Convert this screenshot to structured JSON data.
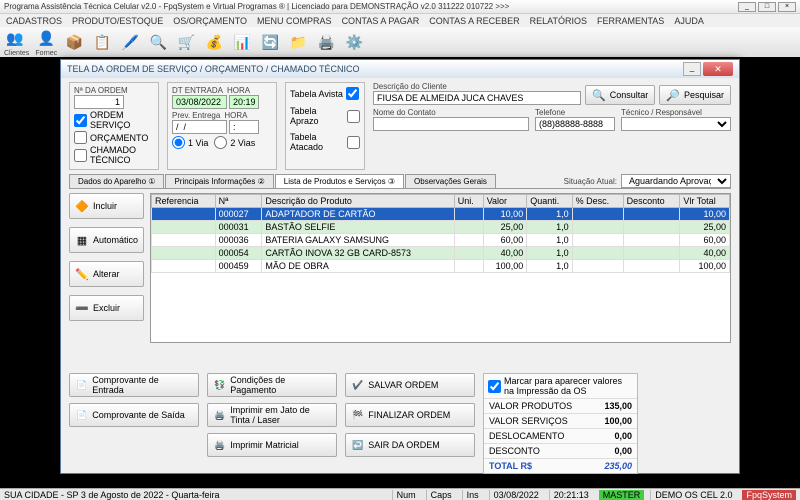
{
  "window": {
    "title": "Programa Assistência Técnica Celular v2.0 - FpqSystem e Virtual Programas ® | Licenciado para DEMONSTRAÇÃO v2.0 311222 010722 >>>"
  },
  "menu": [
    "CADASTROS",
    "PRODUTO/ESTOQUE",
    "OS/ORÇAMENTO",
    "MENU COMPRAS",
    "CONTAS A PAGAR",
    "CONTAS A RECEBER",
    "RELATÓRIOS",
    "FERRAMENTAS",
    "AJUDA"
  ],
  "toolbar": {
    "clientes": "Clientes",
    "fornec": "Fornec"
  },
  "dialog": {
    "title": "TELA DA ORDEM DE SERVIÇO / ORÇAMENTO / CHAMADO TÉCNICO",
    "ordem_lbl": "Nª DA ORDEM",
    "ordem_val": "1",
    "ordem_servico": "ORDEM SERVIÇO",
    "orcamento": "ORÇAMENTO",
    "chamado": "CHAMADO TÉCNICO",
    "dt_entrada_lbl": "DT ENTRADA",
    "dt_entrada": "03/08/2022",
    "hora_lbl": "HORA",
    "hora": "20:19",
    "prev_lbl": "Prev. Entrega",
    "prev": "/  /",
    "prev_hora": ":",
    "via1": "1 Via",
    "via2": "2 Vias",
    "tabela_avista": "Tabela Avista",
    "tabela_aprazo": "Tabela Aprazo",
    "tabela_atacado": "Tabela Atacado",
    "desc_cliente_lbl": "Descrição do Cliente",
    "desc_cliente": "FIUSA DE ALMEIDA JUCA CHAVES",
    "nome_contato_lbl": "Nome do Contato",
    "telefone_lbl": "Telefone",
    "telefone": "(88)88888-8888",
    "tecnico_lbl": "Técnico / Responsável",
    "consultar": "Consultar",
    "pesquisar": "Pesquisar",
    "tabs": [
      "Dados do Aparelho ①",
      "Principais Informações ②",
      "Lista de Produtos e Serviços ③",
      "Observações Gerais"
    ],
    "situacao_lbl": "Situação Atual:",
    "situacao": "Aguardando Aprovação",
    "side": {
      "incluir": "Incluir",
      "automatico": "Automático",
      "alterar": "Alterar",
      "excluir": "Excluir"
    },
    "grid": {
      "headers": [
        "Referencia",
        "Nª",
        "Descrição do Produto",
        "Uni.",
        "Valor",
        "Quanti.",
        "% Desc.",
        "Desconto",
        "Vlr Total"
      ],
      "rows": [
        {
          "ref": "",
          "n": "000027",
          "desc": "ADAPTADOR DE CARTÃO",
          "uni": "",
          "valor": "10,00",
          "qt": "1,0",
          "pd": "",
          "dc": "",
          "tot": "10,00"
        },
        {
          "ref": "",
          "n": "000031",
          "desc": "BASTÃO SELFIE",
          "uni": "",
          "valor": "25,00",
          "qt": "1,0",
          "pd": "",
          "dc": "",
          "tot": "25,00"
        },
        {
          "ref": "",
          "n": "000036",
          "desc": "BATERIA GALAXY SAMSUNG",
          "uni": "",
          "valor": "60,00",
          "qt": "1,0",
          "pd": "",
          "dc": "",
          "tot": "60,00"
        },
        {
          "ref": "",
          "n": "000054",
          "desc": "CARTÃO INOVA 32 GB CARD-8573",
          "uni": "",
          "valor": "40,00",
          "qt": "1,0",
          "pd": "",
          "dc": "",
          "tot": "40,00"
        },
        {
          "ref": "",
          "n": "000459",
          "desc": "MÃO DE OBRA",
          "uni": "",
          "valor": "100,00",
          "qt": "1,0",
          "pd": "",
          "dc": "",
          "tot": "100,00"
        }
      ]
    },
    "bottom": {
      "comp_entrada": "Comprovante de Entrada",
      "comp_saida": "Comprovante de Saída",
      "cond_pag": "Condições de Pagamento",
      "imp_jato": "Imprimir em Jato de Tinta / Laser",
      "imp_mat": "Imprimir Matricial",
      "salvar": "SALVAR ORDEM",
      "finalizar": "FINALIZAR ORDEM",
      "sair": "SAIR DA ORDEM"
    },
    "totals": {
      "check": "Marcar para aparecer valores na Impressão da OS",
      "prod_lbl": "VALOR PRODUTOS",
      "prod": "135,00",
      "serv_lbl": "VALOR SERVIÇOS",
      "serv": "100,00",
      "desloc_lbl": "DESLOCAMENTO",
      "desloc": "0,00",
      "desc_lbl": "DESCONTO",
      "desc": "0,00",
      "total_lbl": "TOTAL R$",
      "total": "235,00"
    }
  },
  "statusbar": {
    "city": "SUA CIDADE - SP  3 de Agosto de 2022 - Quarta-feira",
    "num": "Num",
    "caps": "Caps",
    "ins": "Ins",
    "date": "03/08/2022",
    "time": "20:21:13",
    "master": "MASTER",
    "demo": "DEMO OS CEL 2.0",
    "fpq": "FpqSystem"
  }
}
